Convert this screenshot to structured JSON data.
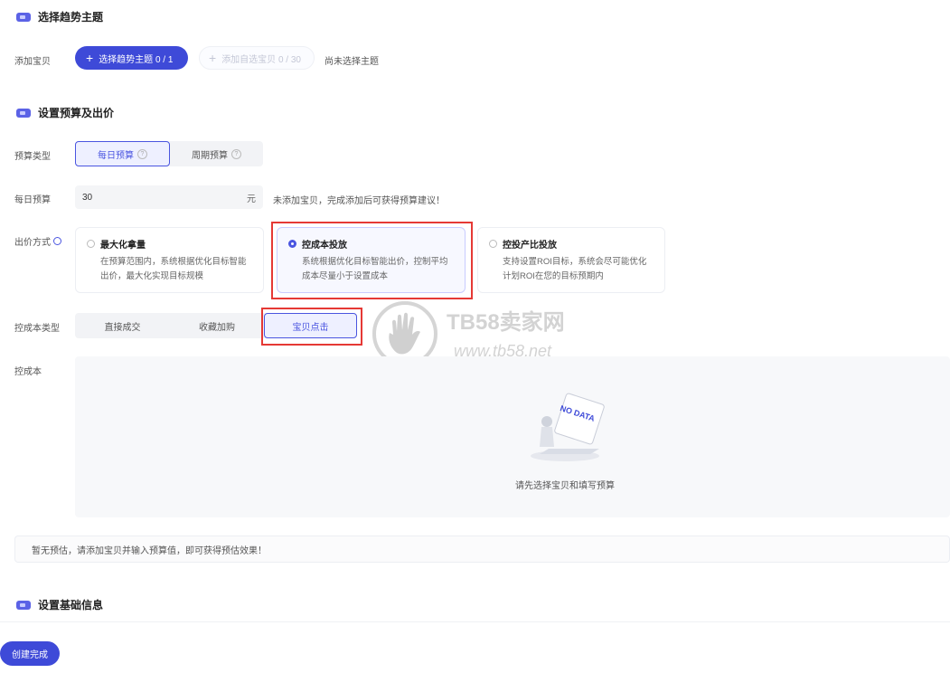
{
  "section1": {
    "title": "选择趋势主题"
  },
  "add_item": {
    "label": "添加宝贝",
    "primary_button": "选择趋势主题 0 / 1",
    "secondary_button": "添加自选宝贝 0 / 30",
    "hint": "尚未选择主题"
  },
  "section2": {
    "title": "设置预算及出价"
  },
  "budget_type": {
    "label": "预算类型",
    "options": [
      "每日预算",
      "周期预算"
    ],
    "selected": "每日预算"
  },
  "daily_budget": {
    "label": "每日预算",
    "value": "30",
    "unit": "元",
    "hint": "未添加宝贝，完成添加后可获得预算建议！"
  },
  "bid_method": {
    "label": "出价方式",
    "cards": [
      {
        "title": "最大化拿量",
        "desc": "在预算范围内，系统根据优化目标智能出价，最大化实现目标规模"
      },
      {
        "title": "控成本投放",
        "desc": "系统根据优化目标智能出价，控制平均成本尽量小于设置成本"
      },
      {
        "title": "控投产比投放",
        "desc": "支持设置ROI目标，系统会尽可能优化计划ROI在您的目标预期内"
      }
    ],
    "selected": "控成本投放"
  },
  "cost_type": {
    "label": "控成本类型",
    "options": [
      "直接成交",
      "收藏加购",
      "宝贝点击"
    ],
    "selected": "宝贝点击"
  },
  "cost": {
    "label": "控成本",
    "empty_badge": "NO DATA",
    "empty_text": "请先选择宝贝和填写预算"
  },
  "estimate_bar": {
    "text": "暂无预估，请添加宝贝并输入预算值，即可获得预估效果！"
  },
  "section3": {
    "title": "设置基础信息"
  },
  "footer": {
    "create_button": "创建完成"
  },
  "watermark": {
    "brand": "TB58卖家网",
    "url": "www.tb58.net"
  },
  "colors": {
    "accent": "#3e4ad8",
    "highlight": "#e53935"
  }
}
